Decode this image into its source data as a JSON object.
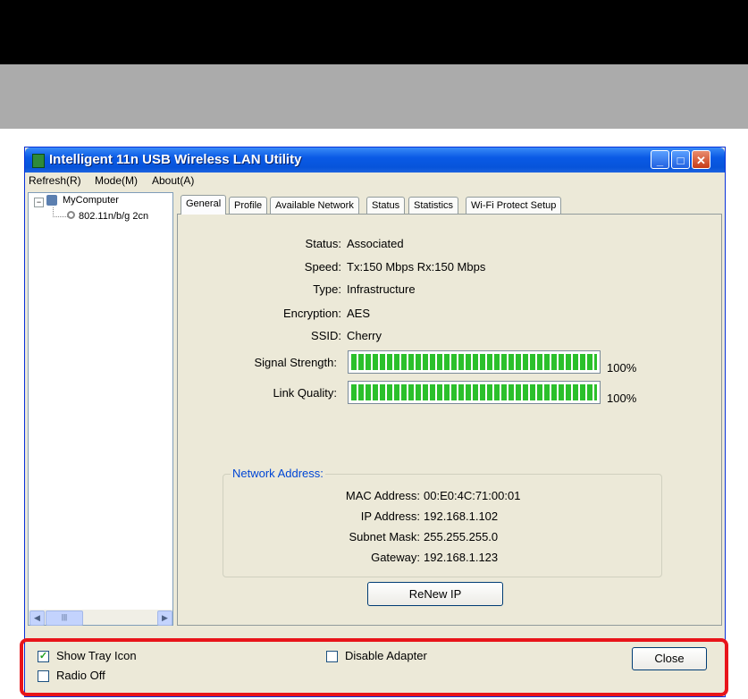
{
  "window": {
    "title": "Intelligent 11n USB Wireless LAN Utility"
  },
  "menu": [
    "Refresh(R)",
    "Mode(M)",
    "About(A)"
  ],
  "tree": {
    "root": "MyComputer",
    "adapter": "802.11n/b/g 2cn"
  },
  "tabs": [
    "General",
    "Profile",
    "Available Network",
    "Status",
    "Statistics",
    "Wi-Fi Protect Setup"
  ],
  "active_tab": "General",
  "general": {
    "status_label": "Status:",
    "status_value": "Associated",
    "speed_label": "Speed:",
    "speed_value": "Tx:150 Mbps Rx:150 Mbps",
    "type_label": "Type:",
    "type_value": "Infrastructure",
    "encryption_label": "Encryption:",
    "encryption_value": "AES",
    "ssid_label": "SSID:",
    "ssid_value": "Cherry",
    "signal_label": "Signal Strength:",
    "signal_percent": "100%",
    "signal_level": 1.0,
    "link_label": "Link Quality:",
    "link_percent": "100%",
    "link_level": 1.0
  },
  "network_address": {
    "title": "Network Address:",
    "mac_label": "MAC Address:",
    "mac_value": "00:E0:4C:71:00:01",
    "ip_label": "IP Address:",
    "ip_value": "192.168.1.102",
    "subnet_label": "Subnet Mask:",
    "subnet_value": "255.255.255.0",
    "gateway_label": "Gateway:",
    "gateway_value": "192.168.1.123"
  },
  "renew_button": "ReNew IP",
  "footer": {
    "show_tray_icon": "Show Tray Icon",
    "show_tray_checked": true,
    "radio_off": "Radio Off",
    "radio_off_checked": false,
    "disable_adapter": "Disable Adapter",
    "disable_adapter_checked": false,
    "close": "Close"
  },
  "highlight_color": "#e8141a"
}
